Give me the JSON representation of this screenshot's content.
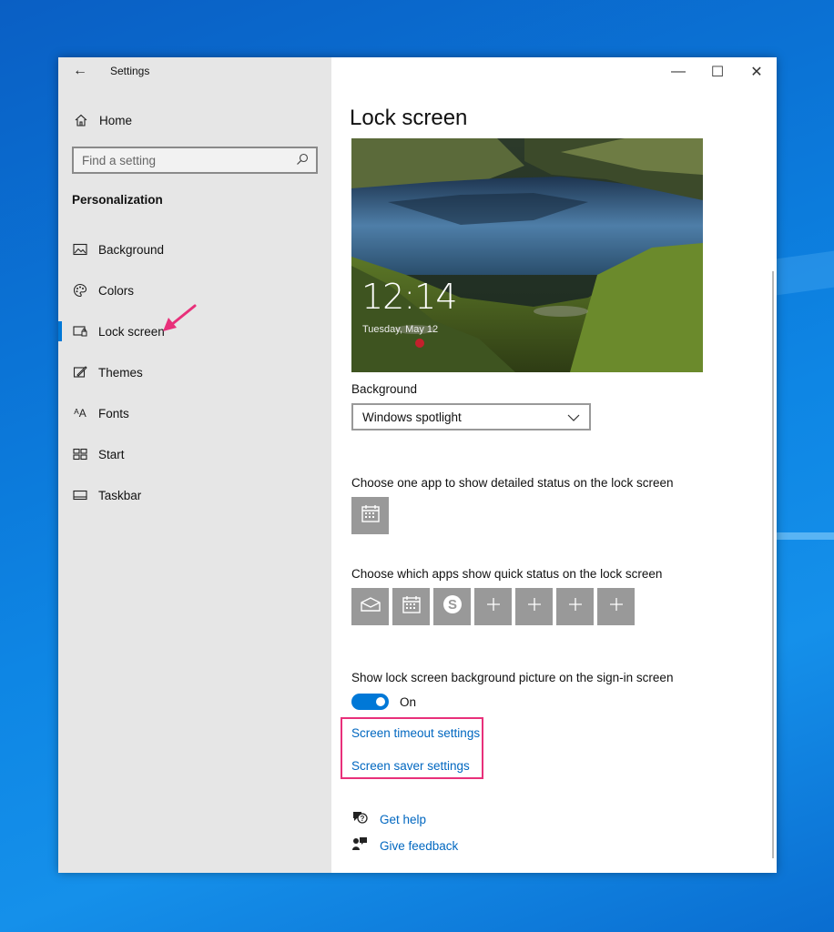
{
  "window": {
    "app_title": "Settings",
    "controls": {
      "minimize": "—",
      "maximize": "☐",
      "close": "✕"
    }
  },
  "sidebar": {
    "home_label": "Home",
    "search": {
      "placeholder": "Find a setting",
      "value": ""
    },
    "section_title": "Personalization",
    "items": [
      {
        "label": "Background",
        "icon": "picture-icon"
      },
      {
        "label": "Colors",
        "icon": "palette-icon"
      },
      {
        "label": "Lock screen",
        "icon": "lock-screen-icon",
        "selected": true
      },
      {
        "label": "Themes",
        "icon": "themes-icon"
      },
      {
        "label": "Fonts",
        "icon": "fonts-icon"
      },
      {
        "label": "Start",
        "icon": "start-icon"
      },
      {
        "label": "Taskbar",
        "icon": "taskbar-icon"
      }
    ]
  },
  "main": {
    "page_title": "Lock screen",
    "preview": {
      "time": "12:14",
      "date": "Tuesday, May 12"
    },
    "background_label": "Background",
    "background_value": "Windows spotlight",
    "detailed_status_label": "Choose one app to show detailed status on the lock screen",
    "detailed_status_app": "calendar-icon",
    "quick_status_label": "Choose which apps show quick status on the lock screen",
    "quick_status_apps": [
      "mail-icon",
      "calendar-icon",
      "skype-icon",
      "add-icon",
      "add-icon",
      "add-icon",
      "add-icon"
    ],
    "signin_label": "Show lock screen background picture on the sign-in screen",
    "signin_toggle_state": "On",
    "signin_toggle_on": true,
    "links": {
      "screen_timeout": "Screen timeout settings",
      "screen_saver": "Screen saver settings"
    },
    "help": {
      "get_help": "Get help",
      "give_feedback": "Give feedback"
    }
  },
  "colors": {
    "accent": "#0078d7",
    "link": "#0067c0",
    "annotation": "#e8307a",
    "sidebar_bg": "#e6e6e6",
    "tile_bg": "#999999"
  }
}
